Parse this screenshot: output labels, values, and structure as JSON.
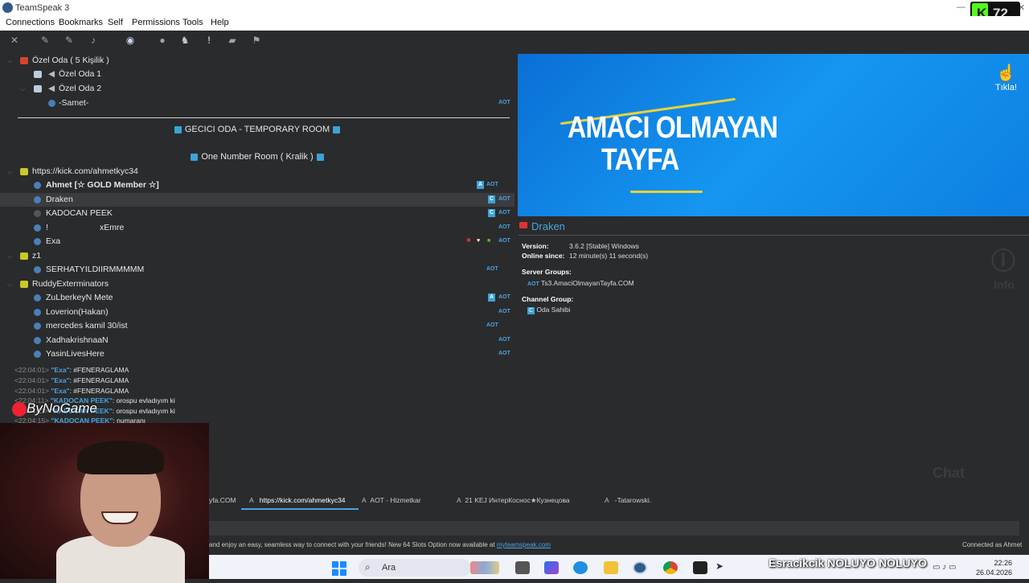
{
  "window": {
    "title": "TeamSpeak 3",
    "minimize": "—",
    "maximize": "□",
    "close": "✕"
  },
  "menu": [
    "Connections",
    "Bookmarks",
    "Self",
    "Permissions",
    "Tools",
    "Help"
  ],
  "toolbar_icons": [
    "disconnect-icon",
    "connect-icon",
    "away-icon",
    "mic-icon",
    "speaker-icon",
    "whisper-icon",
    "contacts-icon",
    "avatar-icon",
    "mute-icon",
    "alert-icon",
    "chat-icon",
    "bookmark-icon"
  ],
  "tree": {
    "channel_ozel": "Özel Oda ( 5 Kişilik )",
    "channel_ozel1": "Özel Oda 1",
    "channel_ozel2": "Özel Oda 2",
    "client_samet": "-Samet-",
    "spacer_temp": "GECICI ODA - TEMPORARY ROOM",
    "spacer_one": "One Number Room ( Kralik )",
    "channel_kick": "https://kick.com/ahmetkyc34",
    "client_ahmet": "Ahmet [☆ GOLD Member ☆]",
    "client_draken": "Draken",
    "client_kadocan": "KADOCAN PEEK",
    "client_emre_prefix": "!",
    "client_emre": "xEmre",
    "client_exa": "Exa",
    "channel_z1": "z1",
    "client_serhat": "SERHATYILDIIRMMMMM",
    "channel_ruddy": "RuddyExterminators",
    "client_zulberkey": "ZuLberkeyN Mete",
    "client_loverion": "Loverion(Hakan)",
    "client_mercedes": "mercedes kamil 30/ist",
    "client_xadhak": "XadhakrishnaaN",
    "client_yasin": "YasinLivesHere",
    "badge_aot": "AOT"
  },
  "banner": {
    "line1": "AMACI OLMAYAN",
    "line2": "TAYFA",
    "click": "Tıkla!"
  },
  "client_info": {
    "name": "Draken",
    "version_label": "Version:",
    "version_value": "3.6.2 [Stable] Windows",
    "online_label": "Online since:",
    "online_value": "12 minute(s) 11 second(s)",
    "server_groups_label": "Server Groups:",
    "server_group": "Ts3.AmaciOlmayanTayfa.COM",
    "channel_group_label": "Channel Group:",
    "channel_group": "Oda Sahibi",
    "info_watermark": "Info",
    "chat_watermark": "Chat"
  },
  "chat": [
    {
      "time": "<22:04:01>",
      "name": "\"Exa\"",
      "msg": ": #FENERAGLAMA"
    },
    {
      "time": "<22:04:01>",
      "name": "\"Exa\"",
      "msg": ": #FENERAGLAMA"
    },
    {
      "time": "<22:04:01>",
      "name": "\"Exa\"",
      "msg": ": #FENERAGLAMA"
    },
    {
      "time": "<22:04:11>",
      "name": "\"KADOCAN PEEK\"",
      "msg": ": orospu evladıyım ki"
    },
    {
      "time": "<22:04:11>",
      "name": "\"KADOCAN PEEK\"",
      "msg": ": orospu evladıyım ki"
    },
    {
      "time": "<22:04:15>",
      "name": "\"KADOCAN PEEK\"",
      "msg": ": numaranı"
    }
  ],
  "webcam": {
    "overlay": "ByNoGame"
  },
  "tabs": [
    "yfa.COM",
    "https://kick.com/ahmetkyc34",
    "AOT - Hizmetkar",
    "21 KEJ ИнтерКоснос★Кузнецова",
    "-Tatarowski."
  ],
  "status": {
    "ad": "and enjoy an easy, seamless way to connect with your friends! New 64 Slots Option now available at",
    "ad_link": "myteamspeak.com",
    "connected": "Connected as Ahmet"
  },
  "taskbar": {
    "search": "Ara",
    "overlay": "Esracikcik  NOLUYO NOLUYO",
    "time": "22:26",
    "date": "26.04.2026"
  },
  "kick_overlay": {
    "count": "72"
  },
  "colors": {
    "accent": "#4aa3df",
    "bg": "#2a2b2d",
    "banner": "#1596f0",
    "kick": "#53fc18"
  }
}
